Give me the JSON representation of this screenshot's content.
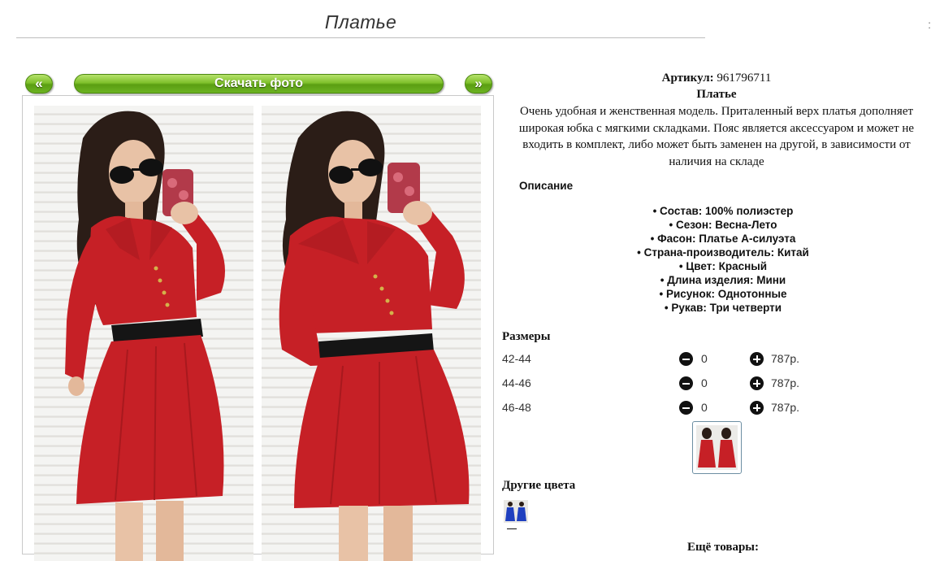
{
  "page": {
    "title": "Платье",
    "corner_mark": ":"
  },
  "gallery": {
    "prev_label": "«",
    "download_label": "Скачать фото",
    "next_label": "»"
  },
  "product": {
    "article_label": "Артикул:",
    "article_value": "961796711",
    "name": "Платье",
    "description": "Очень удобная и женственная модель. Приталенный верх платья дополняет широкая юбка с мягкими складками. Пояс является аксессуаром и может не входить в комплект, либо может быть заменен на другой, в зависимости от наличия на складе"
  },
  "specs_title": "Описание",
  "specs": [
    "Состав: 100% полиэстер",
    "Сезон: Весна-Лето",
    "Фасон: Платье А-силуэта",
    "Страна-производитель: Китай",
    "Цвет: Красный",
    "Длина изделия: Мини",
    "Рисунок: Однотонные",
    "Рукав: Три четверти"
  ],
  "sizes_title": "Размеры",
  "sizes": [
    {
      "size": "42-44",
      "qty": "0",
      "price": "787р."
    },
    {
      "size": "44-46",
      "qty": "0",
      "price": "787р."
    },
    {
      "size": "46-48",
      "qty": "0",
      "price": "787р."
    }
  ],
  "other_colors_title": "Другие цвета",
  "more_products_title": "Ещё товары:",
  "colors": {
    "dress_red": "#c62026",
    "dress_blue": "#1e3fbf",
    "button_green": "#7fc02b",
    "belt": "#151515",
    "hair": "#2b1d17"
  }
}
